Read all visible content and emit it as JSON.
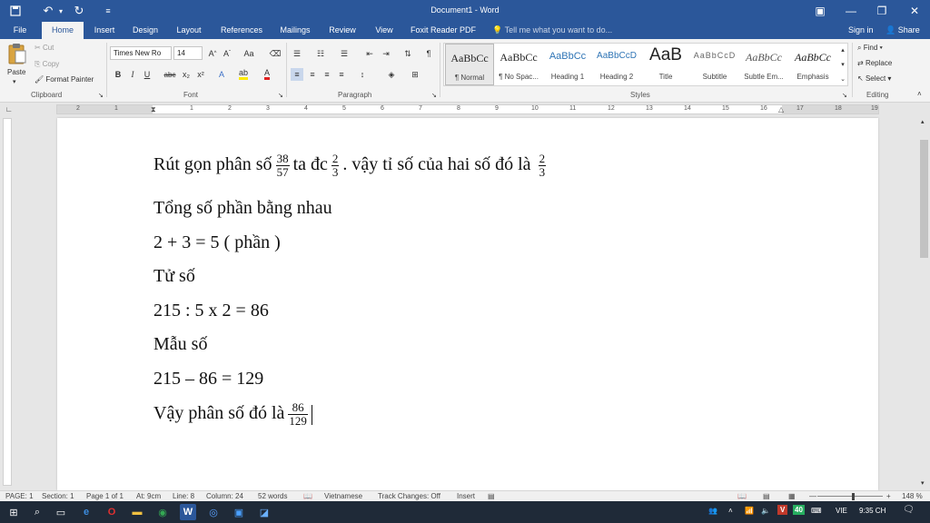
{
  "window": {
    "title": "Document1 - Word",
    "quick_access": {
      "save_icon": "floppy-icon",
      "undo_icon": "undo-icon",
      "redo_icon": "redo-icon"
    }
  },
  "tabs": [
    "File",
    "Home",
    "Insert",
    "Design",
    "Layout",
    "References",
    "Mailings",
    "Review",
    "View",
    "Foxit Reader PDF"
  ],
  "tell_me": "Tell me what you want to do...",
  "sign_in": "Sign in",
  "share": "Share",
  "ribbon": {
    "clipboard": {
      "paste": "Paste",
      "cut": "Cut",
      "copy": "Copy",
      "format_painter": "Format Painter",
      "label": "Clipboard"
    },
    "font": {
      "name": "Times New Ro",
      "size": "14",
      "label": "Font",
      "bold": "B",
      "italic": "I",
      "underline": "U",
      "strike": "abc",
      "sub": "x₂",
      "sup": "x²",
      "grow": "A^",
      "shrink": "Aˇ",
      "case": "Aa"
    },
    "paragraph": {
      "label": "Paragraph",
      "pilcrow": "¶"
    },
    "styles": {
      "label": "Styles",
      "items": [
        {
          "sample": "AaBbCc",
          "name": "¶ Normal"
        },
        {
          "sample": "AaBbCc",
          "name": "¶ No Spac..."
        },
        {
          "sample": "AaBbCc",
          "name": "Heading 1"
        },
        {
          "sample": "AaBbCcD",
          "name": "Heading 2"
        },
        {
          "sample": "AaB",
          "name": "Title"
        },
        {
          "sample": "AaBbCcD",
          "name": "Subtitle"
        },
        {
          "sample": "AaBbCc",
          "name": "Subtle Em..."
        },
        {
          "sample": "AaBbCc",
          "name": "Emphasis"
        }
      ]
    },
    "editing": {
      "find": "Find",
      "replace": "Replace",
      "select": "Select",
      "label": "Editing"
    }
  },
  "ruler_numbers": [
    "2",
    "1",
    "1",
    "2",
    "3",
    "4",
    "5",
    "6",
    "7",
    "8",
    "9",
    "10",
    "11",
    "12",
    "13",
    "14",
    "15",
    "16",
    "17",
    "18",
    "19"
  ],
  "document": {
    "line1_a": "Rút gọn phân số",
    "frac1": {
      "num": "38",
      "den": "57"
    },
    "line1_b": "ta đc",
    "frac2": {
      "num": "2",
      "den": "3"
    },
    "line1_c": ". vậy tỉ số của hai số đó là",
    "frac3": {
      "num": "2",
      "den": "3"
    },
    "line2": "Tổng số phần bằng nhau",
    "line3": "2 + 3 = 5 ( phần )",
    "line4": "Tử số",
    "line5": "215 : 5 x 2 = 86",
    "line6": "Mẫu số",
    "line7": "215 – 86 = 129",
    "line8": "Vậy phân số đó là",
    "frac4": {
      "num": "86",
      "den": "129"
    }
  },
  "status": {
    "page": "PAGE: 1",
    "section": "Section: 1",
    "page_of": "Page 1 of 1",
    "at": "At: 9cm",
    "line": "Line: 8",
    "column": "Column: 24",
    "words": "52 words",
    "language": "Vietnamese",
    "track": "Track Changes: Off",
    "mode": "Insert",
    "zoom": "148 %"
  },
  "taskbar": {
    "lang": "VIE",
    "time": "9:35 CH",
    "battery_badge": "40",
    "v_badge": "V"
  },
  "colors": {
    "word_blue": "#2b579a",
    "taskbar": "#1f2a38"
  }
}
